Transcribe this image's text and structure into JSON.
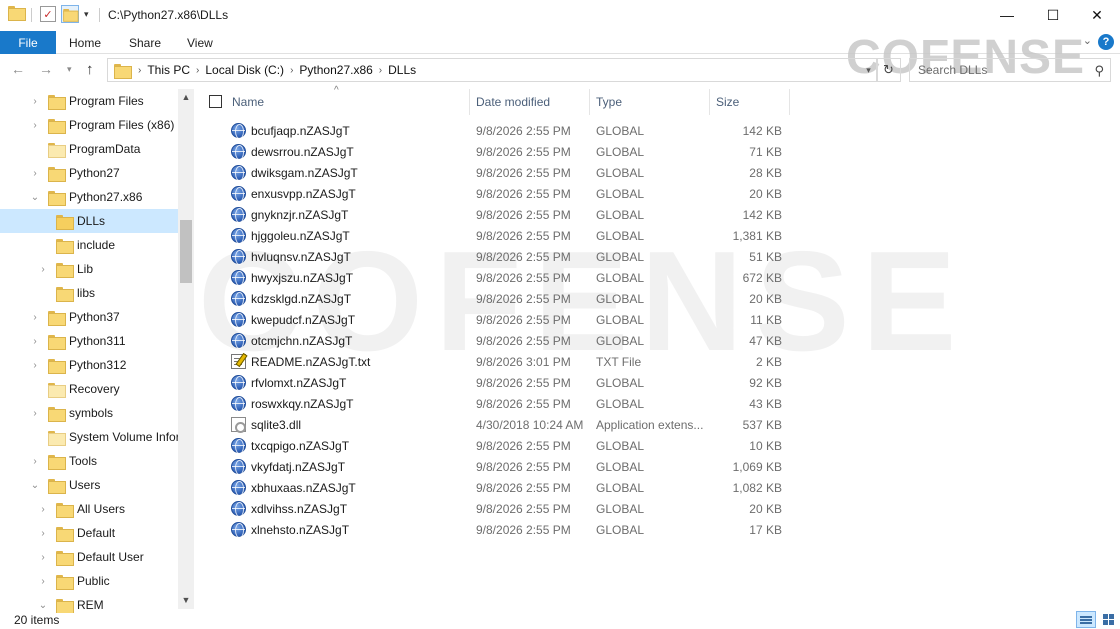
{
  "window": {
    "title": "C:\\Python27.x86\\DLLs",
    "minimize_glyph": "—",
    "maximize_glyph": "☐",
    "close_glyph": "✕"
  },
  "ribbon": {
    "file": "File",
    "home": "Home",
    "share": "Share",
    "view": "View",
    "help": "?"
  },
  "address": {
    "crumbs": [
      "This PC",
      "Local Disk (C:)",
      "Python27.x86",
      "DLLs"
    ]
  },
  "search": {
    "placeholder": "Search DLLs"
  },
  "watermark": {
    "top": "COFENSE",
    "big": "COFENSE"
  },
  "nav": {
    "items": [
      {
        "label": "Program Files",
        "expandable": true,
        "expanded": false
      },
      {
        "label": "Program Files (x86)",
        "expandable": true,
        "expanded": false
      },
      {
        "label": "ProgramData",
        "expandable": false,
        "expanded": false
      },
      {
        "label": "Python27",
        "expandable": true,
        "expanded": false
      },
      {
        "label": "Python27.x86",
        "expandable": true,
        "expanded": true
      },
      {
        "label": "DLLs",
        "expandable": false,
        "expanded": false,
        "selected": true
      },
      {
        "label": "include",
        "expandable": false,
        "expanded": false
      },
      {
        "label": "Lib",
        "expandable": true,
        "expanded": false
      },
      {
        "label": "libs",
        "expandable": false,
        "expanded": false
      },
      {
        "label": "Python37",
        "expandable": true,
        "expanded": false
      },
      {
        "label": "Python311",
        "expandable": true,
        "expanded": false
      },
      {
        "label": "Python312",
        "expandable": true,
        "expanded": false
      },
      {
        "label": "Recovery",
        "expandable": false,
        "expanded": false
      },
      {
        "label": "symbols",
        "expandable": true,
        "expanded": false
      },
      {
        "label": "System Volume Infor",
        "expandable": false,
        "expanded": false
      },
      {
        "label": "Tools",
        "expandable": true,
        "expanded": false
      },
      {
        "label": "Users",
        "expandable": true,
        "expanded": true
      },
      {
        "label": "All Users",
        "expandable": true,
        "expanded": false
      },
      {
        "label": "Default",
        "expandable": true,
        "expanded": false
      },
      {
        "label": "Default User",
        "expandable": true,
        "expanded": false
      },
      {
        "label": "Public",
        "expandable": true,
        "expanded": false
      },
      {
        "label": "REM",
        "expandable": true,
        "expanded": true
      }
    ]
  },
  "columns": {
    "name": "Name",
    "date": "Date modified",
    "type": "Type",
    "size": "Size"
  },
  "files": [
    {
      "name": "bcufjaqp.nZASJgT",
      "date": "9/8/2026 2:55 PM",
      "type": "GLOBAL",
      "size": "142 KB",
      "icon": "globe-icon"
    },
    {
      "name": "dewsrrou.nZASJgT",
      "date": "9/8/2026 2:55 PM",
      "type": "GLOBAL",
      "size": "71 KB",
      "icon": "globe-icon"
    },
    {
      "name": "dwiksgam.nZASJgT",
      "date": "9/8/2026 2:55 PM",
      "type": "GLOBAL",
      "size": "28 KB",
      "icon": "globe-icon"
    },
    {
      "name": "enxusvpp.nZASJgT",
      "date": "9/8/2026 2:55 PM",
      "type": "GLOBAL",
      "size": "20 KB",
      "icon": "globe-icon"
    },
    {
      "name": "gnyknzjr.nZASJgT",
      "date": "9/8/2026 2:55 PM",
      "type": "GLOBAL",
      "size": "142 KB",
      "icon": "globe-icon"
    },
    {
      "name": "hjggoleu.nZASJgT",
      "date": "9/8/2026 2:55 PM",
      "type": "GLOBAL",
      "size": "1,381 KB",
      "icon": "globe-icon"
    },
    {
      "name": "hvluqnsv.nZASJgT",
      "date": "9/8/2026 2:55 PM",
      "type": "GLOBAL",
      "size": "51 KB",
      "icon": "globe-icon"
    },
    {
      "name": "hwyxjszu.nZASJgT",
      "date": "9/8/2026 2:55 PM",
      "type": "GLOBAL",
      "size": "672 KB",
      "icon": "globe-icon"
    },
    {
      "name": "kdzsklgd.nZASJgT",
      "date": "9/8/2026 2:55 PM",
      "type": "GLOBAL",
      "size": "20 KB",
      "icon": "globe-icon"
    },
    {
      "name": "kwepudcf.nZASJgT",
      "date": "9/8/2026 2:55 PM",
      "type": "GLOBAL",
      "size": "11 KB",
      "icon": "globe-icon"
    },
    {
      "name": "otcmjchn.nZASJgT",
      "date": "9/8/2026 2:55 PM",
      "type": "GLOBAL",
      "size": "47 KB",
      "icon": "globe-icon"
    },
    {
      "name": "README.nZASJgT.txt",
      "date": "9/8/2026 3:01 PM",
      "type": "TXT File",
      "size": "2 KB",
      "icon": "text-file-icon"
    },
    {
      "name": "rfvlomxt.nZASJgT",
      "date": "9/8/2026 2:55 PM",
      "type": "GLOBAL",
      "size": "92 KB",
      "icon": "globe-icon"
    },
    {
      "name": "roswxkqy.nZASJgT",
      "date": "9/8/2026 2:55 PM",
      "type": "GLOBAL",
      "size": "43 KB",
      "icon": "globe-icon"
    },
    {
      "name": "sqlite3.dll",
      "date": "4/30/2018 10:24 AM",
      "type": "Application extens...",
      "size": "537 KB",
      "icon": "dll-file-icon"
    },
    {
      "name": "txcqpigo.nZASJgT",
      "date": "9/8/2026 2:55 PM",
      "type": "GLOBAL",
      "size": "10 KB",
      "icon": "globe-icon"
    },
    {
      "name": "vkyfdatj.nZASJgT",
      "date": "9/8/2026 2:55 PM",
      "type": "GLOBAL",
      "size": "1,069 KB",
      "icon": "globe-icon"
    },
    {
      "name": "xbhuxaas.nZASJgT",
      "date": "9/8/2026 2:55 PM",
      "type": "GLOBAL",
      "size": "1,082 KB",
      "icon": "globe-icon"
    },
    {
      "name": "xdlvihss.nZASJgT",
      "date": "9/8/2026 2:55 PM",
      "type": "GLOBAL",
      "size": "20 KB",
      "icon": "globe-icon"
    },
    {
      "name": "xlnehsto.nZASJgT",
      "date": "9/8/2026 2:55 PM",
      "type": "GLOBAL",
      "size": "17 KB",
      "icon": "globe-icon"
    }
  ],
  "status": {
    "item_count": "20 items"
  },
  "colors": {
    "accent": "#1979ca",
    "selection": "#cce8ff",
    "header_text": "#4c607a"
  }
}
